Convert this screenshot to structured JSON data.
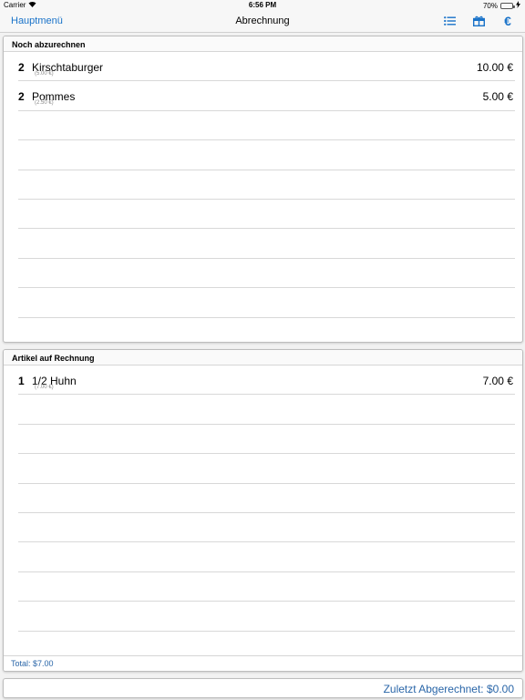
{
  "status": {
    "carrier": "Carrier",
    "time": "6:56 PM",
    "battery": "70%",
    "battery_level": 0.7
  },
  "nav": {
    "back_label": "Hauptmenü",
    "title": "Abrechnung",
    "icons": [
      "list-icon",
      "gift-icon",
      "euro-icon"
    ],
    "euro_symbol": "€",
    "accent_color": "#1a73c9"
  },
  "pending": {
    "header": "Noch abzurechnen",
    "items": [
      {
        "qty": "2",
        "name": "Kirschtaburger",
        "unit": "(5.00 €)",
        "price": "10.00 €"
      },
      {
        "qty": "2",
        "name": "Pommes",
        "unit": "(2.50 €)",
        "price": "5.00 €"
      },
      {
        "qty": "",
        "name": "",
        "unit": "",
        "price": ""
      },
      {
        "qty": "",
        "name": "",
        "unit": "",
        "price": ""
      },
      {
        "qty": "",
        "name": "",
        "unit": "",
        "price": ""
      },
      {
        "qty": "",
        "name": "",
        "unit": "",
        "price": ""
      },
      {
        "qty": "",
        "name": "",
        "unit": "",
        "price": ""
      },
      {
        "qty": "",
        "name": "",
        "unit": "",
        "price": ""
      },
      {
        "qty": "",
        "name": "",
        "unit": "",
        "price": ""
      },
      {
        "qty": "",
        "name": "",
        "unit": "",
        "price": ""
      }
    ]
  },
  "invoice": {
    "header": "Artikel auf Rechnung",
    "items": [
      {
        "qty": "1",
        "name": "1/2 Huhn",
        "unit": "(7.00 €)",
        "price": "7.00 €"
      },
      {
        "qty": "",
        "name": "",
        "unit": "",
        "price": ""
      },
      {
        "qty": "",
        "name": "",
        "unit": "",
        "price": ""
      },
      {
        "qty": "",
        "name": "",
        "unit": "",
        "price": ""
      },
      {
        "qty": "",
        "name": "",
        "unit": "",
        "price": ""
      },
      {
        "qty": "",
        "name": "",
        "unit": "",
        "price": ""
      },
      {
        "qty": "",
        "name": "",
        "unit": "",
        "price": ""
      },
      {
        "qty": "",
        "name": "",
        "unit": "",
        "price": ""
      },
      {
        "qty": "",
        "name": "",
        "unit": "",
        "price": ""
      }
    ],
    "total": "Total: $7.00"
  },
  "footer": {
    "last_billed": "Zuletzt Abgerechnet: $0.00"
  }
}
